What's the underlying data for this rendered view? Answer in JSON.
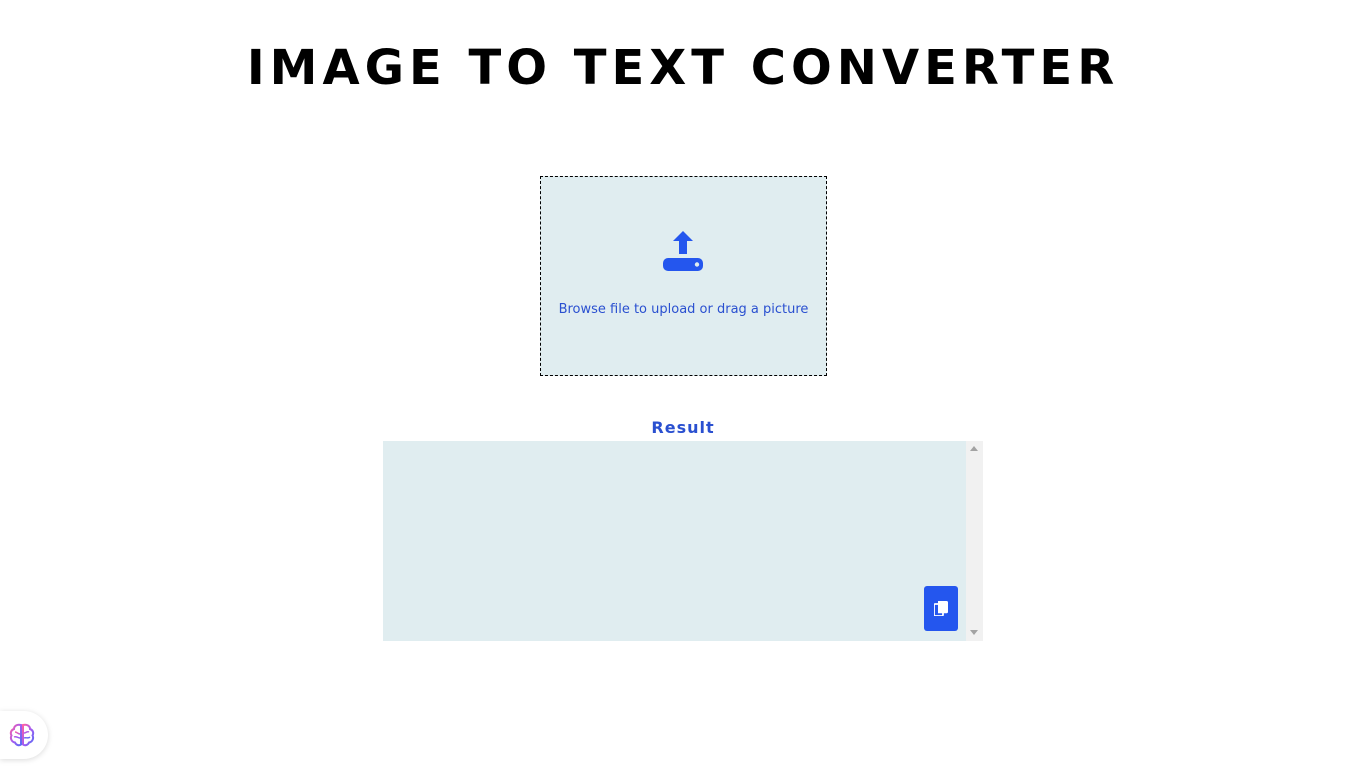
{
  "header": {
    "title": "IMAGE TO TEXT CONVERTER"
  },
  "upload": {
    "prompt": "Browse file to upload or drag a picture",
    "icon": "upload-icon"
  },
  "result": {
    "label": "Result",
    "value": "",
    "copy_icon": "copy-icon"
  },
  "widget": {
    "icon": "brain-icon"
  },
  "colors": {
    "accent": "#2456ee",
    "text_accent": "#2a50d0",
    "panel_bg": "#e0edf0",
    "title": "#000000"
  }
}
